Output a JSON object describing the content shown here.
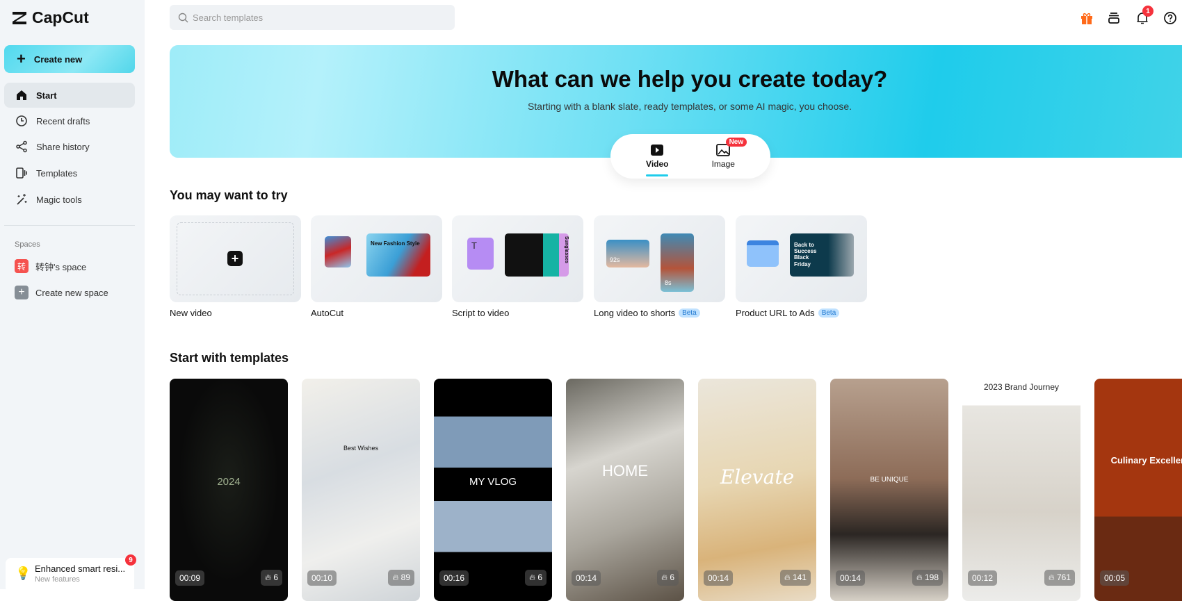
{
  "app": {
    "name": "CapCut"
  },
  "sidebar": {
    "create_label": "Create new",
    "items": [
      {
        "label": "Start",
        "icon": "home-icon"
      },
      {
        "label": "Recent drafts",
        "icon": "clock-icon"
      },
      {
        "label": "Share history",
        "icon": "share-icon"
      },
      {
        "label": "Templates",
        "icon": "templates-icon"
      },
      {
        "label": "Magic tools",
        "icon": "magic-wand-icon"
      }
    ],
    "spaces_label": "Spaces",
    "spaces": [
      {
        "label": "转钟's space",
        "avatar": "转",
        "color": "#f5524f"
      },
      {
        "label": "Create new space",
        "avatar": "+",
        "color": "#868e96"
      }
    ],
    "feature": {
      "title": "Enhanced smart resi...",
      "subtitle": "New features",
      "badge": "9"
    }
  },
  "header": {
    "search_placeholder": "Search templates",
    "notification_count": "1",
    "icons": [
      "gift-icon",
      "layers-icon",
      "bell-icon",
      "help-icon"
    ],
    "gift_color": "#ff6a1a"
  },
  "banner": {
    "title": "What can we help you create today?",
    "subtitle": "Starting with a blank slate, ready templates, or some AI magic, you choose.",
    "tabs": [
      {
        "label": "Video",
        "selected": true
      },
      {
        "label": "Image",
        "badge": "New"
      }
    ]
  },
  "try": {
    "heading": "You may want to try",
    "items": [
      {
        "label": "New video"
      },
      {
        "label": "AutoCut",
        "thumb_text": "New Fashion Style"
      },
      {
        "label": "Script to video",
        "thumb_text": "Sunglasses"
      },
      {
        "label": "Long video to shorts",
        "badge": "Beta",
        "thumb_text": [
          "92s",
          "8s"
        ]
      },
      {
        "label": "Product URL to Ads",
        "badge": "Beta",
        "thumb_text": "Back to Success Black Friday"
      }
    ]
  },
  "templates": {
    "heading": "Start with templates",
    "items": [
      {
        "duration": "00:09",
        "uses": "6",
        "thumb_text": "2024"
      },
      {
        "duration": "00:10",
        "uses": "89",
        "thumb_text": "Best Wishes"
      },
      {
        "duration": "00:16",
        "uses": "6",
        "thumb_text": "MY VLOG"
      },
      {
        "duration": "00:14",
        "uses": "6",
        "thumb_text": "HOME"
      },
      {
        "duration": "00:14",
        "uses": "141",
        "thumb_text": "Elevate"
      },
      {
        "duration": "00:14",
        "uses": "198",
        "thumb_text": "BE UNIQUE"
      },
      {
        "duration": "00:12",
        "uses": "761",
        "thumb_text": "2023 Brand Journey"
      },
      {
        "duration": "00:05",
        "uses": "",
        "thumb_text": "Culinary Excellence"
      }
    ]
  }
}
